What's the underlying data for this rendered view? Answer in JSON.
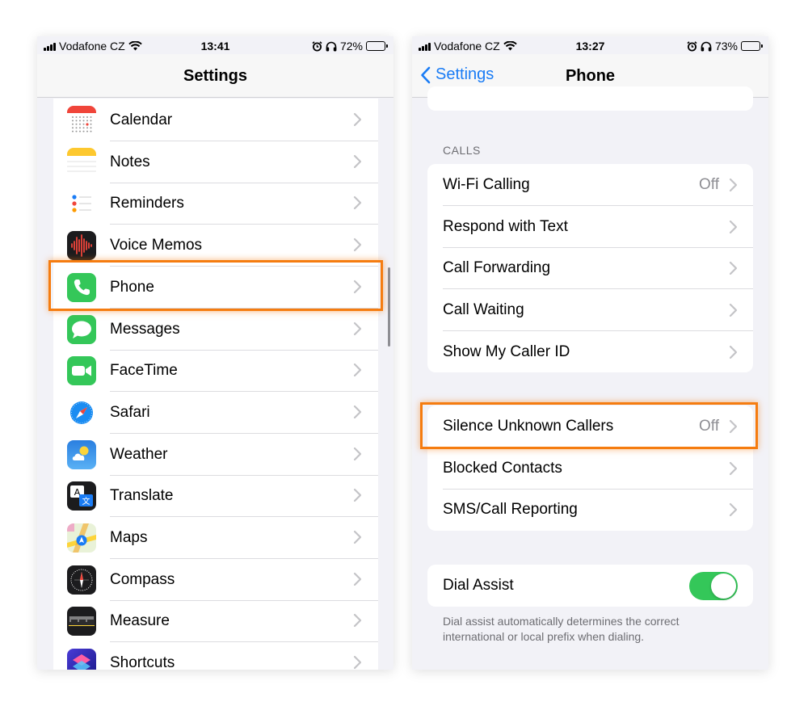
{
  "left_phone": {
    "status": {
      "carrier": "Vodafone CZ",
      "time": "13:41",
      "battery": "72%",
      "battery_level": 0.72
    },
    "title": "Settings",
    "rows": [
      {
        "label": "Calendar",
        "icon": "calendar-icon"
      },
      {
        "label": "Notes",
        "icon": "notes-icon"
      },
      {
        "label": "Reminders",
        "icon": "reminders-icon"
      },
      {
        "label": "Voice Memos",
        "icon": "voice-memos-icon"
      },
      {
        "label": "Phone",
        "icon": "phone-icon"
      },
      {
        "label": "Messages",
        "icon": "messages-icon"
      },
      {
        "label": "FaceTime",
        "icon": "facetime-icon"
      },
      {
        "label": "Safari",
        "icon": "safari-icon"
      },
      {
        "label": "Weather",
        "icon": "weather-icon"
      },
      {
        "label": "Translate",
        "icon": "translate-icon"
      },
      {
        "label": "Maps",
        "icon": "maps-icon"
      },
      {
        "label": "Compass",
        "icon": "compass-icon"
      },
      {
        "label": "Measure",
        "icon": "measure-icon"
      },
      {
        "label": "Shortcuts",
        "icon": "shortcuts-icon"
      }
    ]
  },
  "right_phone": {
    "status": {
      "carrier": "Vodafone CZ",
      "time": "13:27",
      "battery": "73%",
      "battery_level": 0.73
    },
    "back_label": "Settings",
    "title": "Phone",
    "calls_header": "CALLS",
    "calls": [
      {
        "label": "Wi-Fi Calling",
        "value": "Off"
      },
      {
        "label": "Respond with Text",
        "value": ""
      },
      {
        "label": "Call Forwarding",
        "value": ""
      },
      {
        "label": "Call Waiting",
        "value": ""
      },
      {
        "label": "Show My Caller ID",
        "value": ""
      }
    ],
    "blocking": [
      {
        "label": "Silence Unknown Callers",
        "value": "Off"
      },
      {
        "label": "Blocked Contacts",
        "value": ""
      },
      {
        "label": "SMS/Call Reporting",
        "value": ""
      }
    ],
    "dial_assist": {
      "label": "Dial Assist",
      "on": true,
      "note": "Dial assist automatically determines the correct international or local prefix when dialing."
    }
  },
  "colors": {
    "accent": "#1a7cf5",
    "highlight": "#f57c10",
    "toggle_on": "#34c759"
  }
}
